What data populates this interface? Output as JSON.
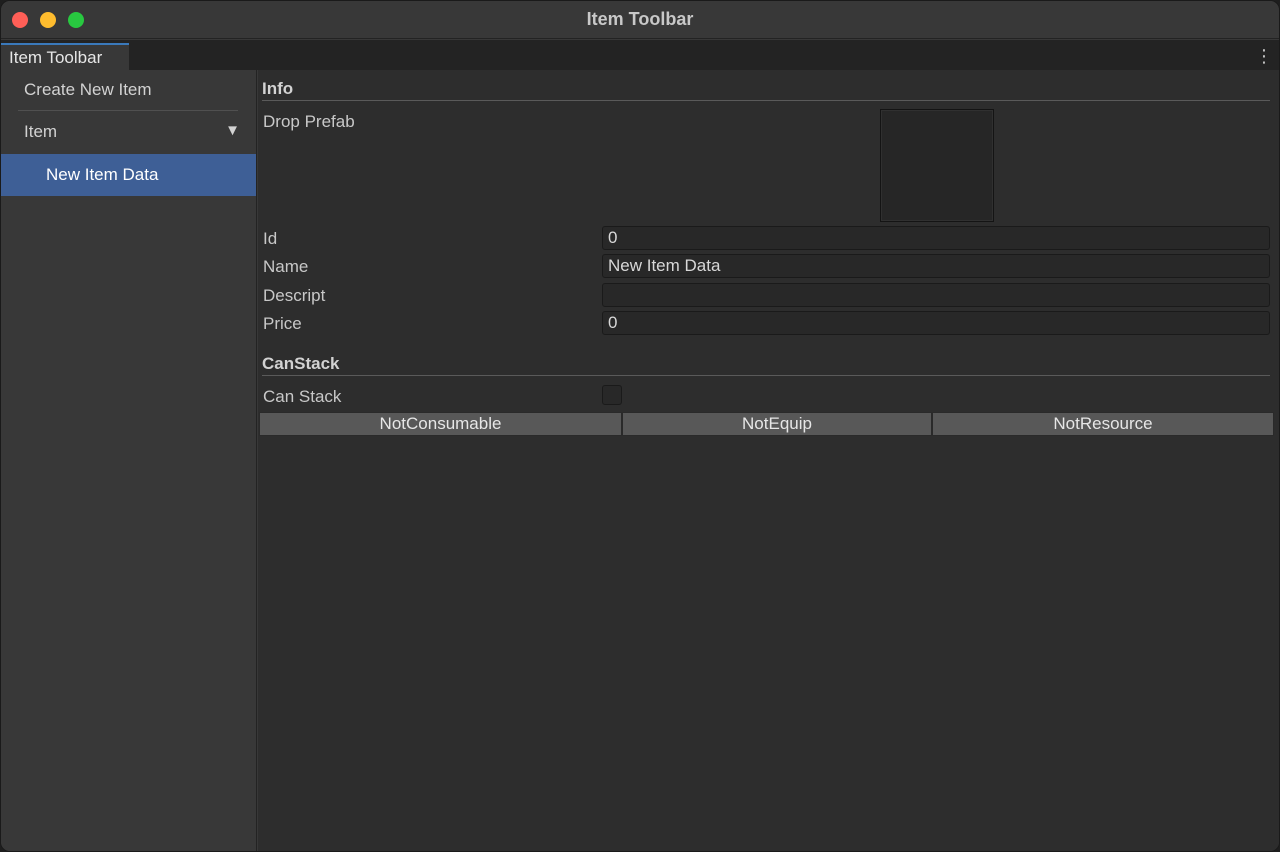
{
  "window": {
    "title": "Item Toolbar"
  },
  "tab": {
    "label": "Item Toolbar"
  },
  "sidebar": {
    "create_label": "Create New Item",
    "group_label": "Item",
    "items": [
      {
        "label": "New Item Data",
        "selected": true
      }
    ]
  },
  "info": {
    "section_title": "Info",
    "drop_prefab_label": "Drop Prefab",
    "fields": {
      "id": {
        "label": "Id",
        "value": "0"
      },
      "name": {
        "label": "Name",
        "value": "New Item Data"
      },
      "descript": {
        "label": "Descript",
        "value": ""
      },
      "price": {
        "label": "Price",
        "value": "0"
      }
    }
  },
  "canstack": {
    "section_title": "CanStack",
    "can_stack_label": "Can Stack",
    "can_stack_checked": false,
    "buttons": [
      "NotConsumable",
      "NotEquip",
      "NotResource"
    ]
  },
  "icons": {
    "window_close": "close-traffic-light-icon",
    "window_minimize": "minimize-traffic-light-icon",
    "window_maximize": "maximize-traffic-light-icon",
    "tab_menu": "kebab-menu-icon",
    "group_toggle": "triangle-down-icon"
  },
  "colors": {
    "selection": "#3e5f96",
    "tab_accent": "#3a79bb",
    "close": "#ff5f57",
    "minimize": "#febc2e",
    "maximize": "#28c840"
  }
}
